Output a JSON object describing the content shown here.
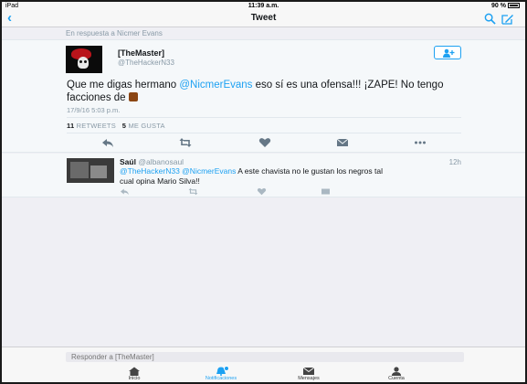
{
  "status_bar": {
    "device": "iPad",
    "time": "11:39 a.m.",
    "battery": "90 %"
  },
  "nav": {
    "title": "Tweet"
  },
  "reply_context": "En respuesta a Nicmer Evans",
  "tweet": {
    "display_name": "[TheMaster]",
    "handle": "@TheHackerN33",
    "text_part1": "Que me digas hermano ",
    "mention": "@NicmerEvans",
    "text_part2": " eso sí es una ofensa!!! ¡ZAPE! No tengo facciones de ",
    "timestamp": "17/9/16 5:03 p.m.",
    "retweets_count": "11",
    "retweets_label": "RETWEETS",
    "likes_count": "5",
    "likes_label": "ME GUSTA"
  },
  "reply": {
    "display_name": "Saúl",
    "handle": "@albanosaul",
    "time": "12h",
    "mention1": "@TheHackerN33",
    "mention2": "@NicmerEvans",
    "text": " A este chavista no le gustan los negros tal cual opina Mario Silva!!"
  },
  "reply_bar": {
    "placeholder": "Responder a [TheMaster]"
  },
  "tabs": [
    {
      "label": "Inicio",
      "icon": "home-icon"
    },
    {
      "label": "Notificaciones",
      "icon": "bell-icon"
    },
    {
      "label": "Mensajes",
      "icon": "envelope-icon"
    },
    {
      "label": "Cuenta",
      "icon": "person-icon"
    }
  ],
  "colors": {
    "accent": "#1da1f2",
    "muted": "#8899a6",
    "text": "#14171a"
  }
}
